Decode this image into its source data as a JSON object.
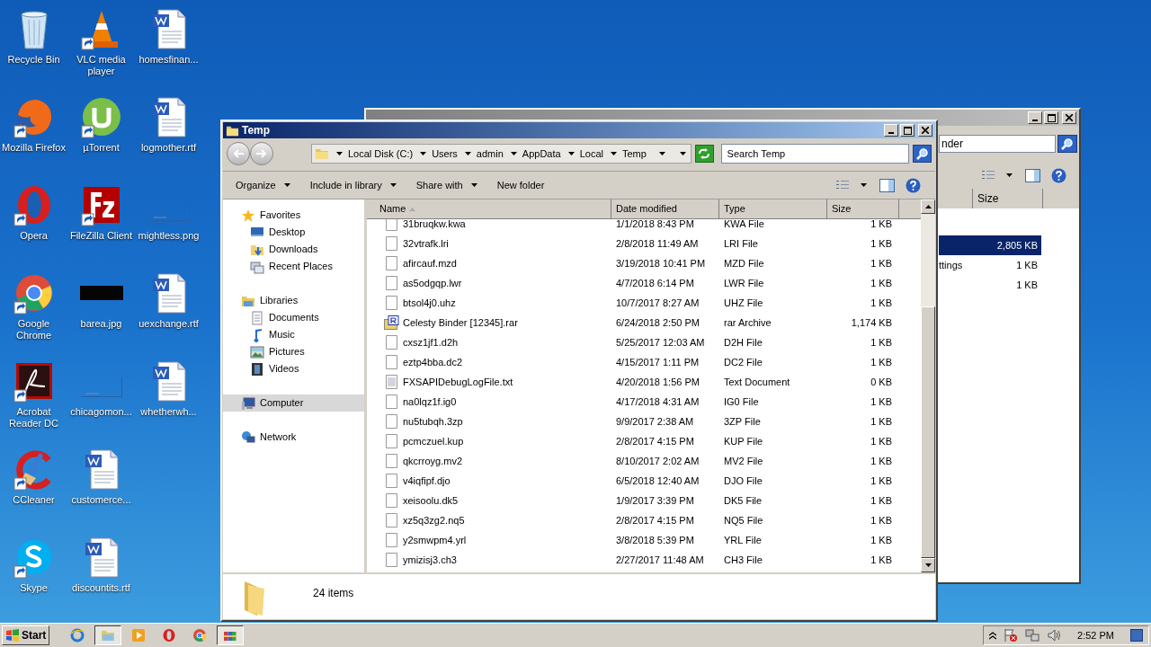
{
  "desktop_icons": [
    {
      "label": "Recycle Bin",
      "kind": "recycle",
      "shortcut": false
    },
    {
      "label": "Mozilla Firefox",
      "kind": "firefox",
      "shortcut": true
    },
    {
      "label": "Opera",
      "kind": "opera",
      "shortcut": true
    },
    {
      "label": "Google Chrome",
      "kind": "chrome",
      "shortcut": true
    },
    {
      "label": "Acrobat Reader DC",
      "kind": "acrobat",
      "shortcut": true
    },
    {
      "label": "CCleaner",
      "kind": "ccleaner",
      "shortcut": true
    },
    {
      "label": "Skype",
      "kind": "skype",
      "shortcut": true
    },
    {
      "label": "VLC media player",
      "kind": "vlc",
      "shortcut": true
    },
    {
      "label": "µTorrent",
      "kind": "utorrent",
      "shortcut": true
    },
    {
      "label": "FileZilla Client",
      "kind": "filezilla",
      "shortcut": true
    },
    {
      "label": "barea.jpg",
      "kind": "thumb-dark",
      "shortcut": false
    },
    {
      "label": "chicagomon...",
      "kind": "thumb-light",
      "shortcut": false
    },
    {
      "label": "customerce...",
      "kind": "word",
      "shortcut": false
    },
    {
      "label": "discountits.rtf",
      "kind": "word",
      "shortcut": false
    },
    {
      "label": "homesfinan...",
      "kind": "word",
      "shortcut": false
    },
    {
      "label": "logmother.rtf",
      "kind": "word",
      "shortcut": false
    },
    {
      "label": "mightless.png",
      "kind": "thumb-light",
      "shortcut": false
    },
    {
      "label": "uexchange.rtf",
      "kind": "word",
      "shortcut": false
    },
    {
      "label": "whetherwh...",
      "kind": "word",
      "shortcut": false
    }
  ],
  "background_window": {
    "search_value": "nder",
    "columns": [
      "Size"
    ],
    "rows": [
      {
        "size": "2,805 KB",
        "selected": true
      },
      {
        "name": "ttings",
        "size": "1 KB",
        "selected": false
      },
      {
        "size": "1 KB",
        "selected": false
      }
    ]
  },
  "window": {
    "title": "Temp",
    "breadcrumb": [
      "Local Disk (C:)",
      "Users",
      "admin",
      "AppData",
      "Local",
      "Temp"
    ],
    "search": {
      "placeholder": "Search Temp"
    },
    "toolbar": [
      {
        "label": "Organize",
        "dropdown": true
      },
      {
        "label": "Include in library",
        "dropdown": true
      },
      {
        "label": "Share with",
        "dropdown": true
      },
      {
        "label": "New folder",
        "dropdown": false
      }
    ],
    "sidebar": {
      "items": [
        {
          "label": "Favorites",
          "kind": "favorites",
          "selected": false,
          "children": [
            {
              "label": "Desktop",
              "kind": "desktop",
              "selected": false
            },
            {
              "label": "Downloads",
              "kind": "downloads",
              "selected": false
            },
            {
              "label": "Recent Places",
              "kind": "recent",
              "selected": false
            }
          ]
        },
        {
          "label": "Libraries",
          "kind": "libraries",
          "selected": false,
          "children": [
            {
              "label": "Documents",
              "kind": "documents",
              "selected": false
            },
            {
              "label": "Music",
              "kind": "music",
              "selected": false
            },
            {
              "label": "Pictures",
              "kind": "pictures",
              "selected": false
            },
            {
              "label": "Videos",
              "kind": "videos",
              "selected": false
            }
          ]
        },
        {
          "label": "Computer",
          "kind": "computer",
          "selected": true
        },
        {
          "label": "Network",
          "kind": "network",
          "selected": false
        }
      ]
    },
    "table": {
      "columns": [
        "Name",
        "Date modified",
        "Type",
        "Size"
      ],
      "rows": [
        {
          "name": "31bruqkw.kwa",
          "date": "1/1/2018 8:43 PM",
          "type": "KWA File",
          "size": "1 KB",
          "kind": "file"
        },
        {
          "name": "32vtrafk.lri",
          "date": "2/8/2018 11:49 AM",
          "type": "LRI File",
          "size": "1 KB",
          "kind": "file"
        },
        {
          "name": "afircauf.mzd",
          "date": "3/19/2018 10:41 PM",
          "type": "MZD File",
          "size": "1 KB",
          "kind": "file"
        },
        {
          "name": "as5odgqp.lwr",
          "date": "4/7/2018 6:14 PM",
          "type": "LWR File",
          "size": "1 KB",
          "kind": "file"
        },
        {
          "name": "btsol4j0.uhz",
          "date": "10/7/2017 8:27 AM",
          "type": "UHZ File",
          "size": "1 KB",
          "kind": "file"
        },
        {
          "name": "Celesty Binder [12345].rar",
          "date": "6/24/2018 2:50 PM",
          "type": "rar Archive",
          "size": "1,174 KB",
          "kind": "archive"
        },
        {
          "name": "cxsz1jf1.d2h",
          "date": "5/25/2017 12:03 AM",
          "type": "D2H File",
          "size": "1 KB",
          "kind": "file"
        },
        {
          "name": "eztp4bba.dc2",
          "date": "4/15/2017 1:11 PM",
          "type": "DC2 File",
          "size": "1 KB",
          "kind": "file"
        },
        {
          "name": "FXSAPIDebugLogFile.txt",
          "date": "4/20/2018 1:56 PM",
          "type": "Text Document",
          "size": "0 KB",
          "kind": "text"
        },
        {
          "name": "na0lqz1f.ig0",
          "date": "4/17/2018 4:31 AM",
          "type": "IG0 File",
          "size": "1 KB",
          "kind": "file"
        },
        {
          "name": "nu5tubqh.3zp",
          "date": "9/9/2017 2:38 AM",
          "type": "3ZP File",
          "size": "1 KB",
          "kind": "file"
        },
        {
          "name": "pcmczuel.kup",
          "date": "2/8/2017 4:15 PM",
          "type": "KUP File",
          "size": "1 KB",
          "kind": "file"
        },
        {
          "name": "qkcrroyg.mv2",
          "date": "8/10/2017 2:02 AM",
          "type": "MV2 File",
          "size": "1 KB",
          "kind": "file"
        },
        {
          "name": "v4iqfipf.djo",
          "date": "6/5/2018 12:40 AM",
          "type": "DJO File",
          "size": "1 KB",
          "kind": "file"
        },
        {
          "name": "xeisoolu.dk5",
          "date": "1/9/2017 3:39 PM",
          "type": "DK5 File",
          "size": "1 KB",
          "kind": "file"
        },
        {
          "name": "xz5q3zg2.nq5",
          "date": "2/8/2017 4:15 PM",
          "type": "NQ5 File",
          "size": "1 KB",
          "kind": "file"
        },
        {
          "name": "y2smwpm4.yrl",
          "date": "3/8/2018 5:39 PM",
          "type": "YRL File",
          "size": "1 KB",
          "kind": "file"
        },
        {
          "name": "ymizisj3.ch3",
          "date": "2/27/2017 11:48 AM",
          "type": "CH3 File",
          "size": "1 KB",
          "kind": "file"
        }
      ]
    },
    "status_bar": {
      "count": "24 items"
    }
  },
  "taskbar": {
    "start": "Start",
    "items": [
      {
        "kind": "ie",
        "selected": false
      },
      {
        "kind": "explorer",
        "selected": true
      },
      {
        "kind": "media",
        "selected": false
      },
      {
        "kind": "opera",
        "selected": false
      },
      {
        "kind": "chrome",
        "selected": false
      },
      {
        "kind": "archive",
        "selected": true
      }
    ],
    "clock": "2:52 PM"
  }
}
